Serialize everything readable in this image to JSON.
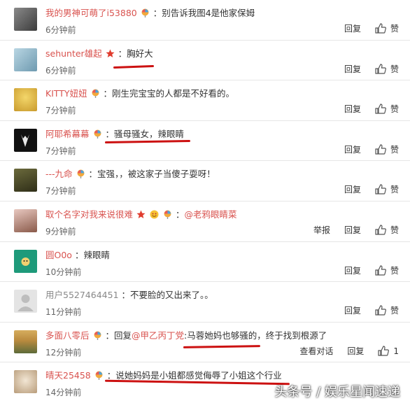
{
  "comments": [
    {
      "user": "我的男神可萌了i53880",
      "text": "：别告诉我图4是他家保姆",
      "time": "6分钟前",
      "reply": "回复",
      "like": "赞"
    },
    {
      "user": "sehunter雄起",
      "text": "：胸好大",
      "time": "6分钟前",
      "reply": "回复",
      "like": "赞"
    },
    {
      "user": "KITTY妞妞",
      "text": "：刚生完宝宝的人都是不好看的。",
      "time": "7分钟前",
      "reply": "回复",
      "like": "赞"
    },
    {
      "user": "阿耶希幕幕",
      "text": "：骚母骚女，辣眼睛",
      "time": "7分钟前",
      "reply": "回复",
      "like": "赞"
    },
    {
      "user": "---九命",
      "text": "：宝强，，被这家子当傻子耍呀！",
      "time": "7分钟前",
      "reply": "回复",
      "like": "赞"
    },
    {
      "user": "取个名字对我来说很难",
      "text": "：",
      "mention": "@老鸦眼睛菜",
      "time": "9分钟前",
      "report": "举报",
      "reply": "回复",
      "like": "赞"
    },
    {
      "user": "圆O0o",
      "text": "：辣眼睛",
      "time": "10分钟前",
      "reply": "回复",
      "like": "赞"
    },
    {
      "user": "用户5527464451",
      "text": "：不要脸的又出来了。。",
      "time": "11分钟前",
      "reply": "回复",
      "like": "赞"
    },
    {
      "user": "多面八零后",
      "text_prefix": "：回复",
      "mention": "@甲乙丙丁党",
      "text": ":马蓉她妈也够骚的，终于找到根源了",
      "time": "12分钟前",
      "view": "查看对话",
      "reply": "回复",
      "like_count": "1"
    },
    {
      "user": "晴天25458",
      "text": "：说她妈妈是小姐都感觉侮辱了小姐这个行业",
      "time": "14分钟前"
    }
  ],
  "watermark": "头条号 / 娱乐星闻速递",
  "colors": {
    "username": "#d9534f",
    "annotation": "#cc1111"
  }
}
